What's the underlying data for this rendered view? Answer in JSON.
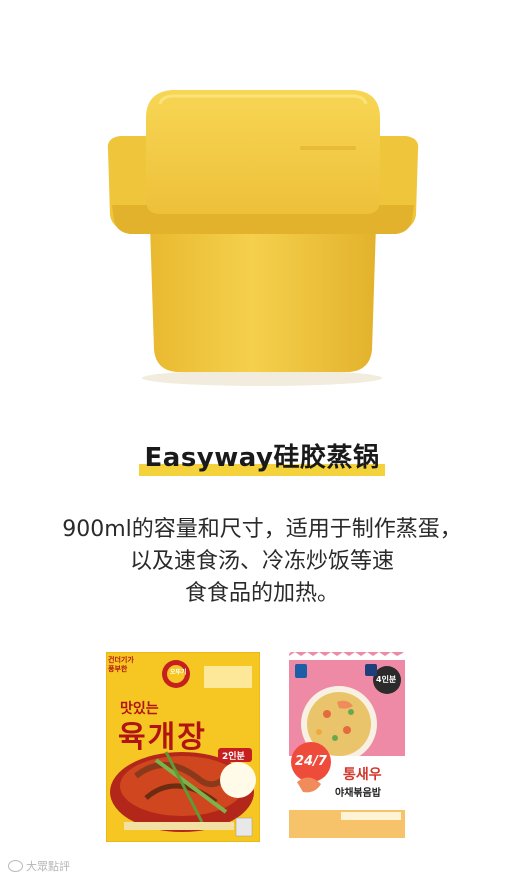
{
  "hero": {
    "product_icon": "yellow-silicone-steamer"
  },
  "title": "Easyway硅胶蒸锅",
  "description_lines": [
    "900ml的容量和尺寸，适用于制作蒸蛋，",
    "以及速食汤、冷冻炒饭等速",
    "食食品的加热。"
  ],
  "packages": {
    "left": {
      "brand": "오뚜기",
      "subtitle": "맛있는",
      "name": "육개장",
      "portion": "2인분",
      "corner_note": "건더기가\n풍부한"
    },
    "right": {
      "badge": "24/7",
      "portion": "4인분",
      "name_line1": "통새우",
      "name_line2": "야채볶음밥"
    }
  },
  "watermark": {
    "text": "大眾點評"
  },
  "colors": {
    "accent_yellow": "#f4d23b",
    "steamer_yellow": "#f2cb45",
    "pkg_left_yellow": "#f6c623",
    "pkg_left_red": "#c61f1f",
    "pkg_right_pink": "#ef8aa6"
  }
}
